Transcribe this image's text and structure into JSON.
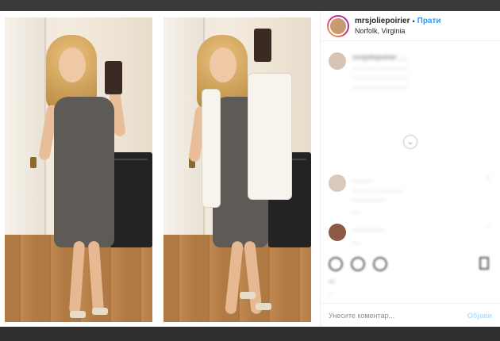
{
  "header": {
    "username": "mrsjoliepoirier",
    "separator": "•",
    "follow_label": "Прати",
    "location": "Norfolk, Virginia"
  },
  "comments": {
    "caption_lines": [
      "mrsjoliepoirier ....",
      "............................",
      "............................",
      "............................"
    ],
    "load_more_icon": "chevron-down-icon",
    "items": [
      {
        "lines": [
          "..........",
          ".........................",
          "................"
        ],
        "meta": "...."
      },
      {
        "lines": [
          "................"
        ],
        "meta": "...."
      }
    ]
  },
  "actions": {
    "icons": [
      "heart-icon",
      "comment-icon",
      "share-icon",
      "bookmark-icon"
    ],
    "likes_text": "...",
    "date_text": "..."
  },
  "comment_box": {
    "placeholder": "Унесите коментар...",
    "post_label": "Објави"
  },
  "colors": {
    "accent": "#3897f0",
    "post_button_disabled": "#b2dffc"
  }
}
